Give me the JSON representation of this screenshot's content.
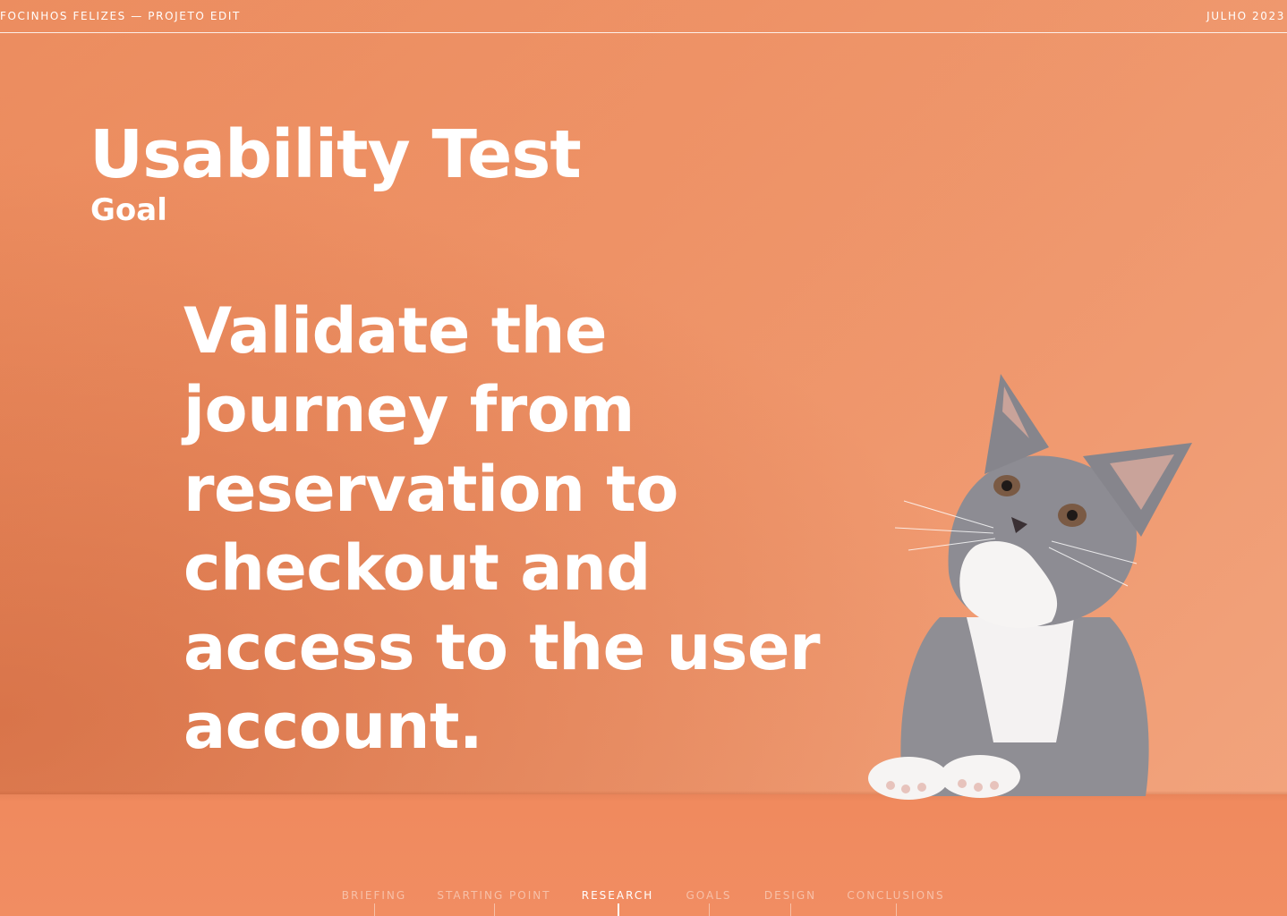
{
  "header": {
    "project_label": "FOCINHOS FELIZES — PROJETO EDIT",
    "date_label": "JULHO 2023"
  },
  "slide": {
    "title": "Usability Test",
    "subtitle": "Goal",
    "statement": "Validate the journey from reservation to checkout and access to the user account."
  },
  "nav": {
    "items": [
      {
        "label": "BRIEFING",
        "active": false
      },
      {
        "label": "STARTING POINT",
        "active": false
      },
      {
        "label": "RESEARCH",
        "active": true
      },
      {
        "label": "GOALS",
        "active": false
      },
      {
        "label": "DESIGN",
        "active": false
      },
      {
        "label": "CONCLUSIONS",
        "active": false
      }
    ]
  },
  "colors": {
    "background": "#ee9266",
    "text": "#ffffff",
    "nav_inactive": "rgba(255,255,255,0.45)"
  }
}
